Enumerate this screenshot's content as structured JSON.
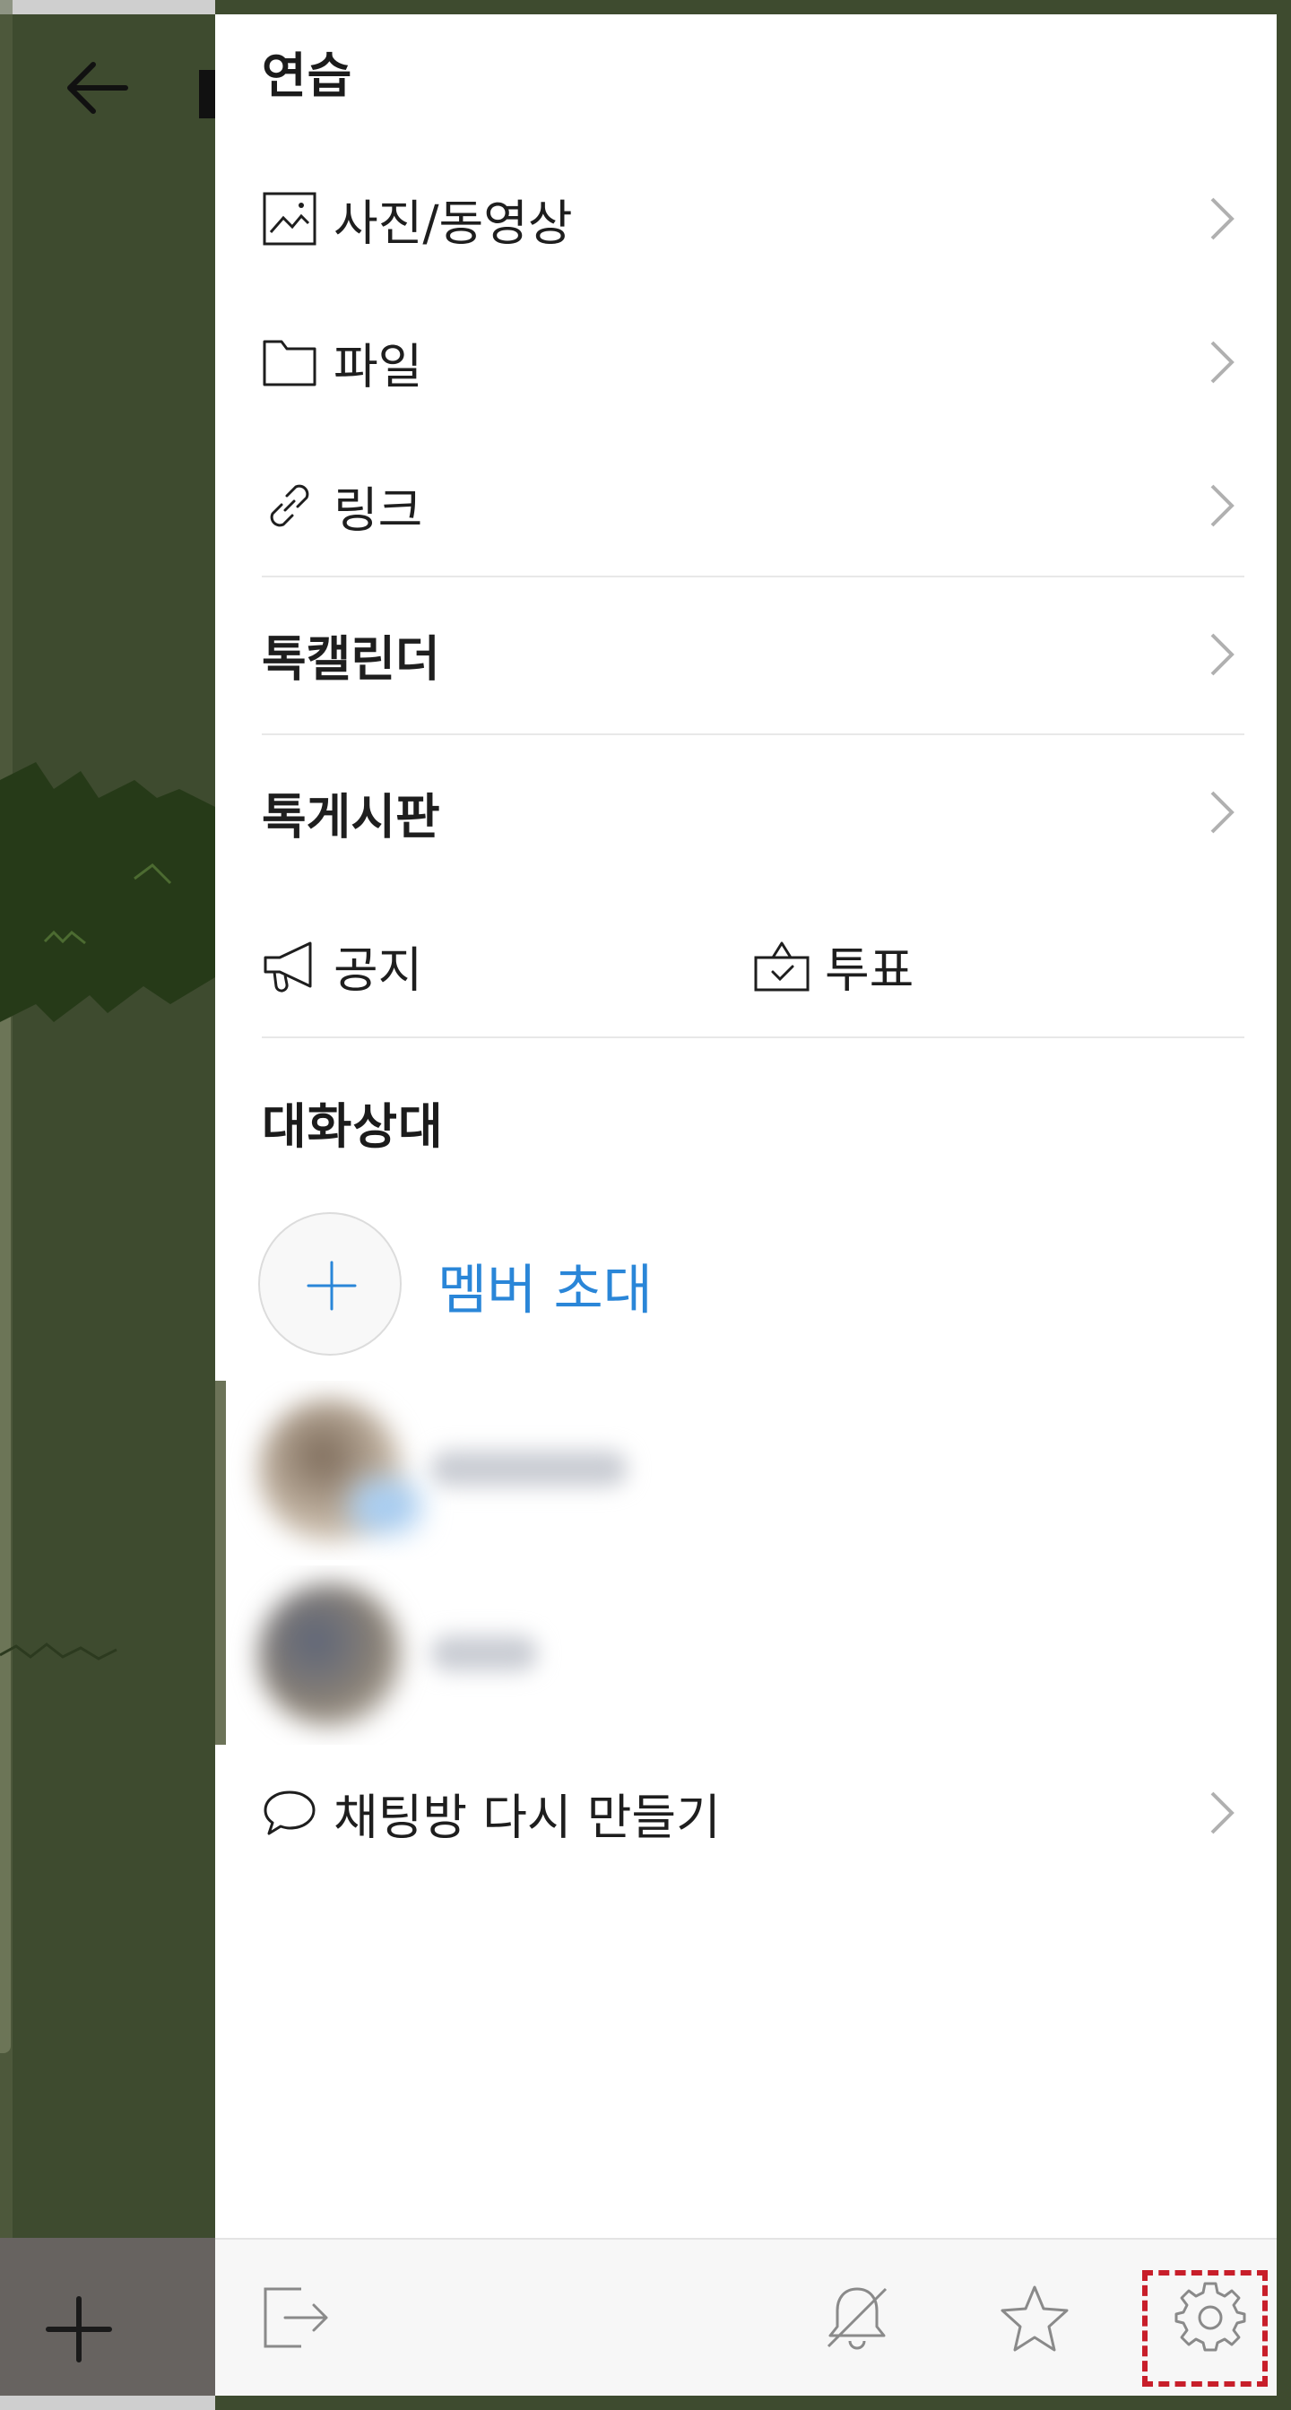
{
  "chat_room": {
    "title": "연습"
  },
  "menu": {
    "media_label": "사진/동영상",
    "files_label": "파일",
    "links_label": "링크",
    "calendar_label": "톡캘린더",
    "board_label": "톡게시판",
    "notice_label": "공지",
    "poll_label": "투표"
  },
  "members": {
    "section_title": "대화상대",
    "invite_label": "멤버 초대"
  },
  "recreate_label": "채팅방 다시 만들기",
  "colors": {
    "accent_blue": "#2a86d8",
    "highlight_red": "#c81e2a",
    "dim_background": "#3e4b2f"
  },
  "icons": {
    "back": "arrow-left-icon",
    "media": "image-icon",
    "files": "folder-icon",
    "links": "link-icon",
    "notice": "megaphone-icon",
    "poll": "ballot-box-icon",
    "invite": "plus-icon",
    "recreate": "speech-bubble-icon",
    "leave": "exit-icon",
    "mute": "bell-off-icon",
    "favorite": "star-icon",
    "settings": "gear-icon"
  }
}
